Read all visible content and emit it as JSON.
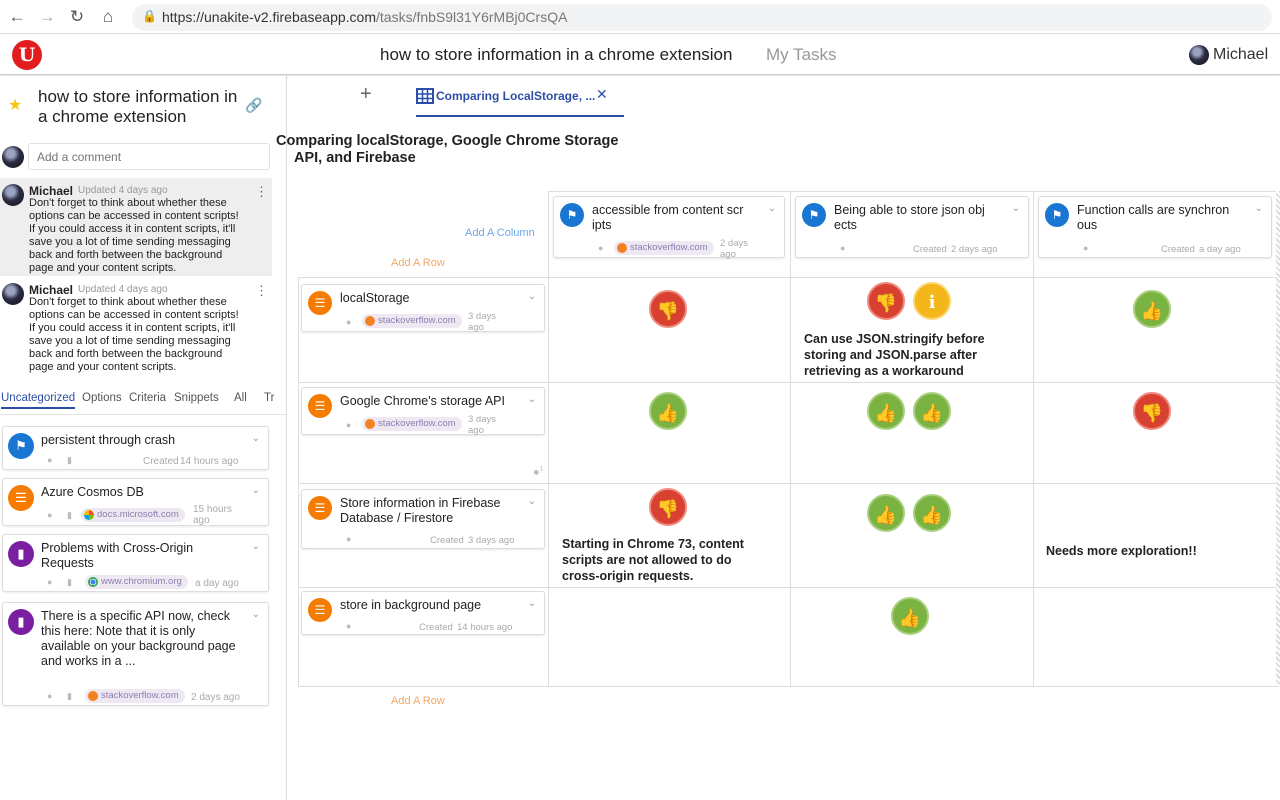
{
  "browser": {
    "url_host": "https://unakite-v2.firebaseapp.com",
    "url_path": "/tasks/fnbS9l31Y6rMBj0CrsQA"
  },
  "header": {
    "logo": "U",
    "title": "how to store information in a chrome extension",
    "my_tasks": "My Tasks",
    "user": "Michael"
  },
  "sidebar": {
    "task_title": "how to store information in a chrome extension",
    "comment_placeholder": "Add a comment",
    "comments": [
      {
        "name": "Michael",
        "updated": "Updated 4 days ago",
        "body": "Don't forget to think about whether these options can be accessed in content scripts! If you could access it in content scripts, it'll save you a lot of time sending messaging back and forth between the background page and your content scripts."
      },
      {
        "name": "Michael",
        "updated": "Updated 4 days ago",
        "body": "Don't forget to think about whether these options can be accessed in content scripts! If you could access it in content scripts, it'll save you a lot of time sending messaging back and forth between the background page and your content scripts."
      }
    ],
    "tabs": [
      "Uncategorized",
      "Options",
      "Criteria",
      "Snippets",
      "All",
      "Tr"
    ],
    "snippets": [
      {
        "text": "persistent through crash",
        "meta": "Created",
        "time": "14 hours ago",
        "icon": "flag-icon",
        "color": "#1976d2"
      },
      {
        "text": "Azure Cosmos DB",
        "source": "docs.microsoft.com",
        "time": "15 hours ago",
        "icon": "list-icon",
        "color": "#f57c00"
      },
      {
        "text": "Problems with Cross-Origin Requests",
        "source": "www.chromium.org",
        "time": "a day ago",
        "icon": "bookmark-icon",
        "color": "#7b1fa2"
      },
      {
        "text": "There is a specific API now, check this here: Note that it is only available on your background page and works in a ...",
        "source": "stackoverflow.com",
        "time": "2 days ago",
        "icon": "bookmark-icon",
        "color": "#7b1fa2"
      }
    ]
  },
  "main": {
    "tab_label": "Comparing LocalStorage, ...",
    "table_title": "Comparing localStorage, Google Chrome Storage API, and Firebase",
    "add_column": "Add A Column",
    "add_row": "Add A Row",
    "criteria": [
      {
        "text": "accessible from content scr ipts",
        "source": "stackoverflow.com",
        "time": "2 days ago"
      },
      {
        "text": "Being able to store json obj ects",
        "meta": "Created",
        "time": "2 days ago"
      },
      {
        "text": "Function calls are synchron ous",
        "meta": "Created",
        "time": "a day ago"
      }
    ],
    "options": [
      {
        "text": "localStorage",
        "source": "stackoverflow.com",
        "time": "3 days ago"
      },
      {
        "text": "Google Chrome's storage API",
        "source": "stackoverflow.com",
        "time": "3 days ago",
        "comments": "1"
      },
      {
        "text": "Store information in Firebase Database / Firestore",
        "meta": "Created",
        "time": "3 days ago"
      },
      {
        "text": "store in background page",
        "meta": "Created",
        "time": "14 hours ago"
      }
    ],
    "notes": {
      "r0c1": "Can use JSON.stringify before storing and JSON.parse after retrieving as a workaround",
      "r2c0": "Starting in Chrome 73, content scripts are not allowed to do cross-origin requests.",
      "r2c2": "Needs more exploration!!"
    },
    "ratings": [
      [
        "down",
        "down+info",
        "up"
      ],
      [
        "up",
        "up+up",
        "down"
      ],
      [
        "down",
        "up+up",
        ""
      ],
      [
        "",
        "up",
        ""
      ]
    ]
  }
}
